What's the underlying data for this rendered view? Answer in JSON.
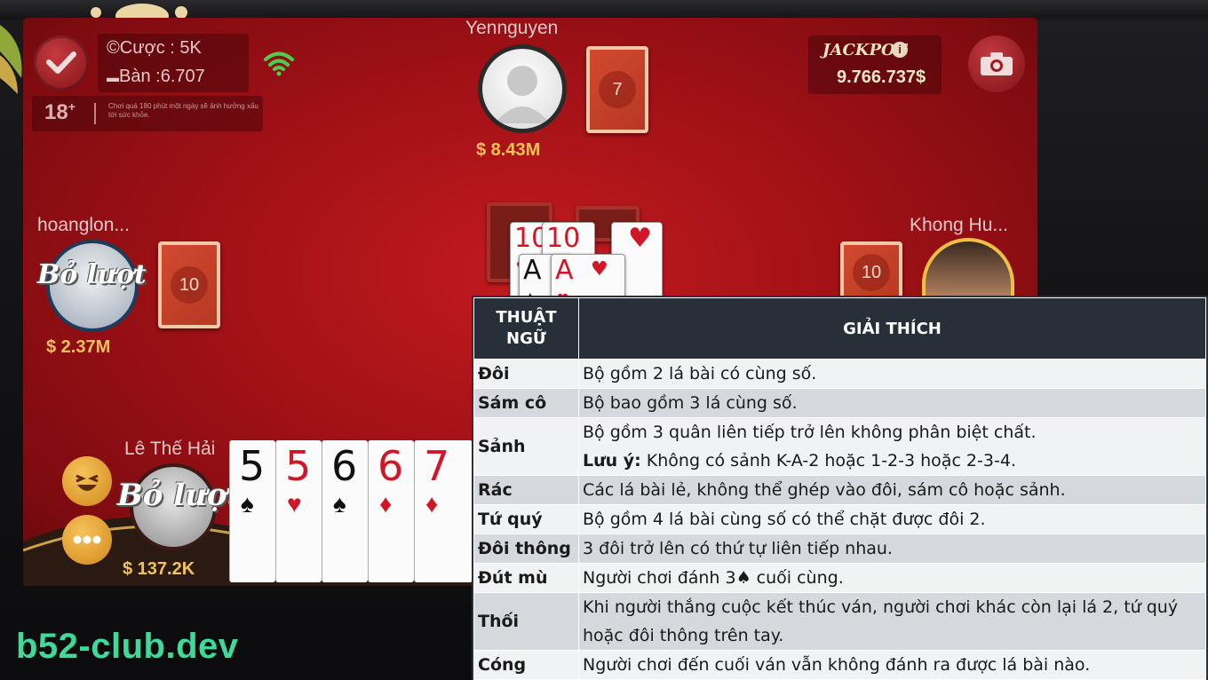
{
  "game": {
    "bet_label": "Cược : 5K",
    "table_label": "Bàn :6.707",
    "age_label": "18",
    "age_plus": "+",
    "age_note": "Chơi quá 180 phút một ngày sẽ ảnh hưởng xấu tới sức khỏe.",
    "jackpot_label": "JACKPOT",
    "jackpot_info": "i",
    "jackpot_value": "9.766.737$"
  },
  "players": {
    "top": {
      "name": "Yennguyen",
      "money": "$ 8.43M",
      "cards_left": "7"
    },
    "left": {
      "name": "hoanglon...",
      "money": "$ 2.37M",
      "cards_left": "10",
      "status": "Bỏ lượt"
    },
    "right": {
      "name": "Khong Hu...",
      "cards_left": "10"
    },
    "self": {
      "name": "Lê Thế Hải",
      "money": "$ 137.2K",
      "status": "Bỏ lượt"
    }
  },
  "table_cards": [
    {
      "rank": "10",
      "suit": "♥",
      "color": "red"
    },
    {
      "rank": "10",
      "suit": "♥",
      "color": "red"
    },
    {
      "rank": "A",
      "suit": "♠",
      "color": "black"
    },
    {
      "rank": "A",
      "suit": "♥",
      "color": "red"
    }
  ],
  "hand_cards": [
    {
      "rank": "5",
      "suit": "♠",
      "color": "black"
    },
    {
      "rank": "5",
      "suit": "♥",
      "color": "red"
    },
    {
      "rank": "6",
      "suit": "♠",
      "color": "black"
    },
    {
      "rank": "6",
      "suit": "♦",
      "color": "red"
    },
    {
      "rank": "7",
      "suit": "♦",
      "color": "red"
    }
  ],
  "icons": {
    "check": "check-icon",
    "wifi": "wifi-icon",
    "camera": "camera-icon",
    "emoji": "laughing-face-icon",
    "chat": "chat-bubble-icon"
  },
  "watermark": "b52-club.dev",
  "terms": {
    "header_term": "THUẬT NGỮ",
    "header_desc": "GIẢI THÍCH",
    "rows": [
      {
        "term": "Đôi",
        "desc": "Bộ gồm 2 lá bài có cùng số."
      },
      {
        "term": "Sám cô",
        "desc": "Bộ bao gồm 3 lá cùng số."
      },
      {
        "term": "Sảnh",
        "desc": "Bộ gồm 3 quân liên tiếp trở lên không phân biệt chất.",
        "note_label": "Lưu ý:",
        "note": " Không có sảnh K-A-2 hoặc 1-2-3 hoặc 2-3-4."
      },
      {
        "term": "Rác",
        "desc": "Các lá bài lẻ, không thể ghép vào đôi, sám cô hoặc sảnh."
      },
      {
        "term": "Tứ quý",
        "desc": "Bộ gồm 4 lá bài cùng số có thể chặt được đôi 2."
      },
      {
        "term": "Đôi thông",
        "desc": "3 đôi trở lên có thứ tự liên tiếp nhau."
      },
      {
        "term": "Đút mù",
        "desc": "Người chơi đánh 3♠ cuối cùng."
      },
      {
        "term": "Thối",
        "desc": "Khi người thắng cuộc kết thúc ván, người chơi khác còn lại lá 2, tứ quý hoặc đôi thông trên tay."
      },
      {
        "term": "Cóng",
        "desc": "Người chơi đến cuối ván vẫn không đánh ra được lá bài nào."
      }
    ]
  }
}
